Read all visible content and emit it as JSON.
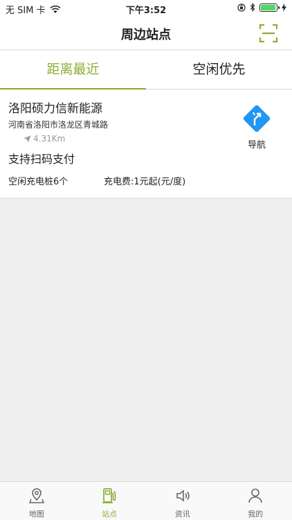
{
  "status_bar": {
    "carrier": "无 SIM 卡",
    "time": "下午3:52",
    "battery_level": 0.95,
    "battery_color": "#4cd964"
  },
  "nav": {
    "title": "周边站点",
    "scan_icon": "scan-icon"
  },
  "tabs": [
    {
      "label": "距离最近",
      "active": true
    },
    {
      "label": "空闲优先",
      "active": false
    }
  ],
  "station": {
    "name": "洛阳硕力信新能源",
    "address": "河南省洛阳市洛龙区青城路",
    "distance": "4.31Km",
    "payment": "支持扫码支付",
    "idle_piles": "空闲充电桩6个",
    "fee": "充电费:1元起(元/度)",
    "nav_label": "导航"
  },
  "tab_bar": {
    "items": [
      {
        "label": "地图",
        "icon": "map-pin-icon",
        "active": false
      },
      {
        "label": "站点",
        "icon": "charging-station-icon",
        "active": true
      },
      {
        "label": "资讯",
        "icon": "speaker-icon",
        "active": false
      },
      {
        "label": "我的",
        "icon": "user-icon",
        "active": false
      }
    ]
  },
  "colors": {
    "accent": "#8cae34",
    "nav_diamond": "#2196f3",
    "background": "#efefef"
  }
}
